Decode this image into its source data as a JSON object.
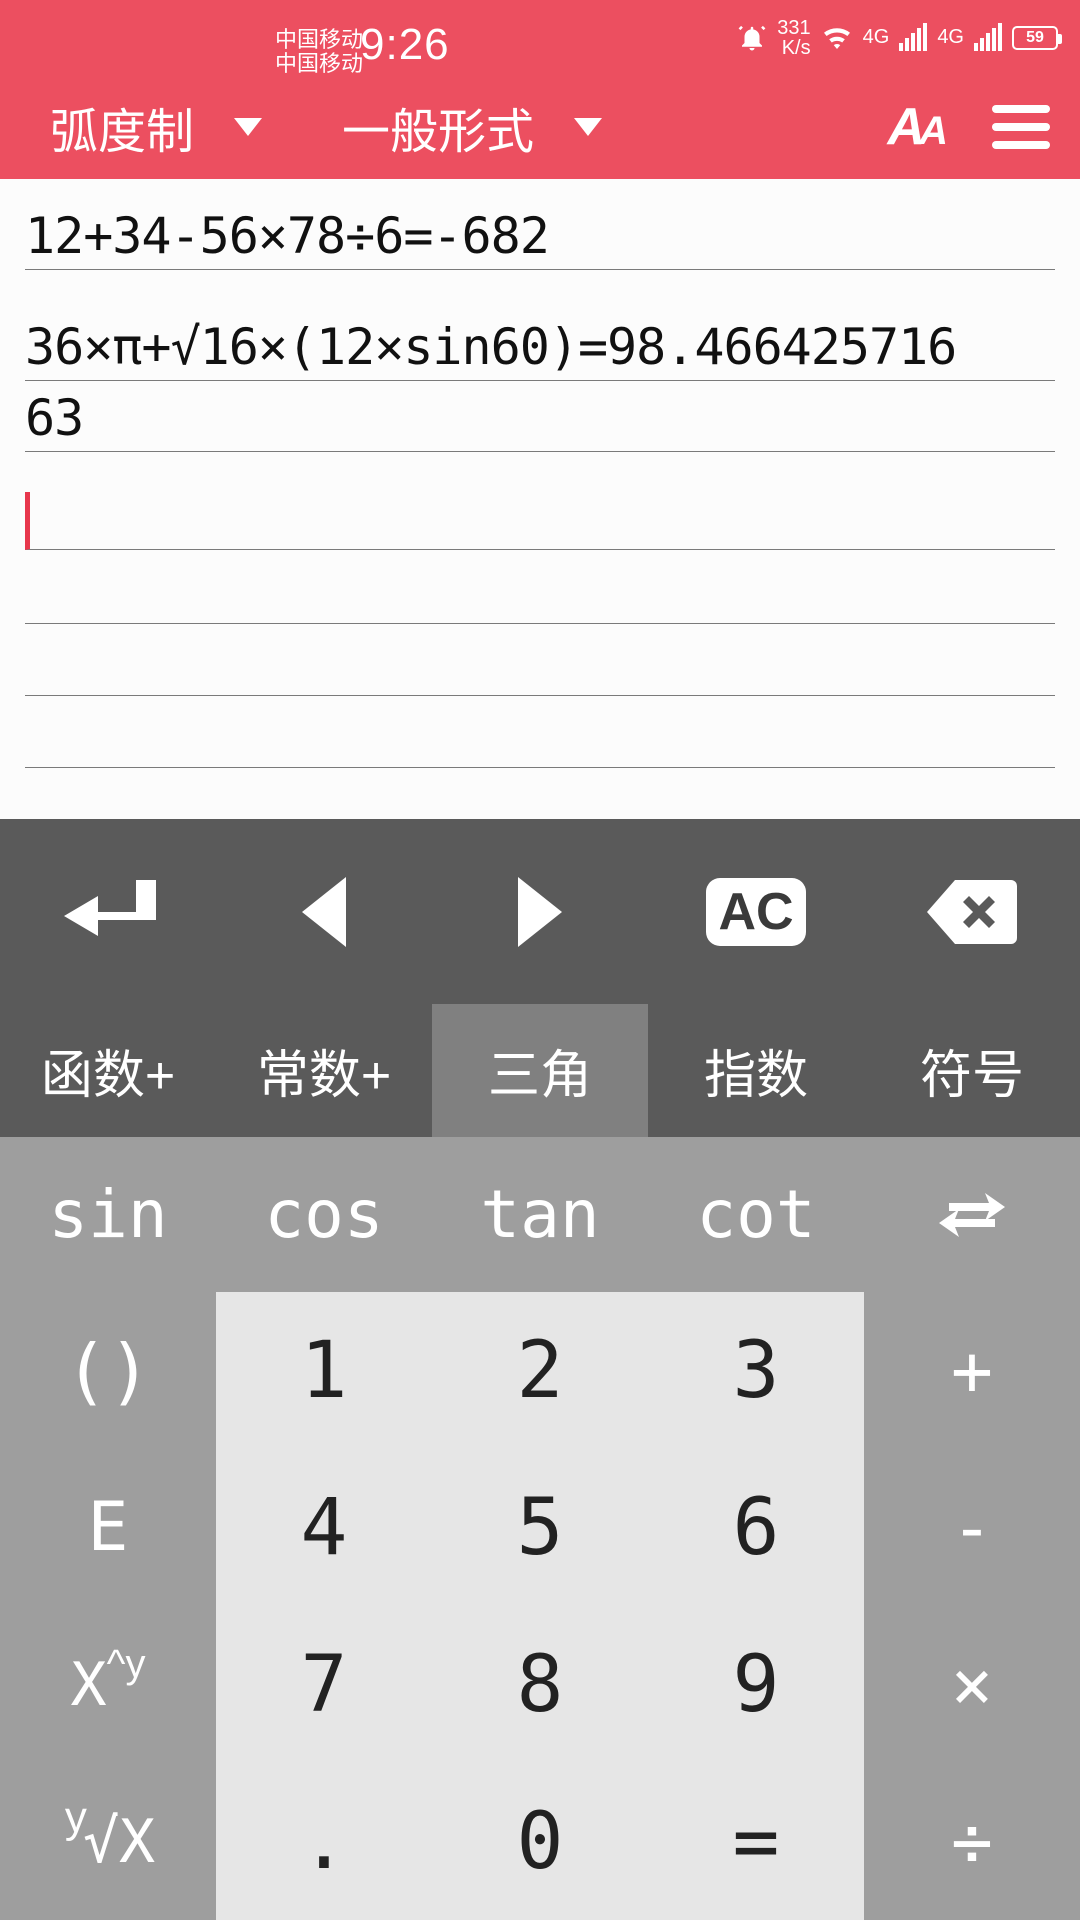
{
  "status": {
    "carrier1": "中国移动",
    "carrier2": "中国移动",
    "clock": "9:26",
    "netspeed_top": "331",
    "netspeed_bot": "K/s",
    "net_label": "4G",
    "battery": "59"
  },
  "appbar": {
    "mode_label": "弧度制",
    "form_label": "一般形式"
  },
  "sheet": {
    "line1": "12+34-56×78÷6=-682",
    "line2": "36×π+√16×(12×sin60)=98.466425716",
    "line2b": "63"
  },
  "editrow": {
    "ac": "AC"
  },
  "tabs": {
    "t1": "函数+",
    "t2": "常数+",
    "t3": "三角",
    "t4": "指数",
    "t5": "符号"
  },
  "trig": {
    "sin": "sin",
    "cos": "cos",
    "tan": "tan",
    "cot": "cot"
  },
  "keys": {
    "paren": "()",
    "E": "E",
    "xy": "X^y",
    "root": "ʸ√X",
    "n1": "1",
    "n2": "2",
    "n3": "3",
    "n4": "4",
    "n5": "5",
    "n6": "6",
    "n7": "7",
    "n8": "8",
    "n9": "9",
    "n0": "0",
    "dot": ".",
    "eq": "=",
    "plus": "+",
    "minus": "-",
    "times": "×",
    "div": "÷"
  }
}
